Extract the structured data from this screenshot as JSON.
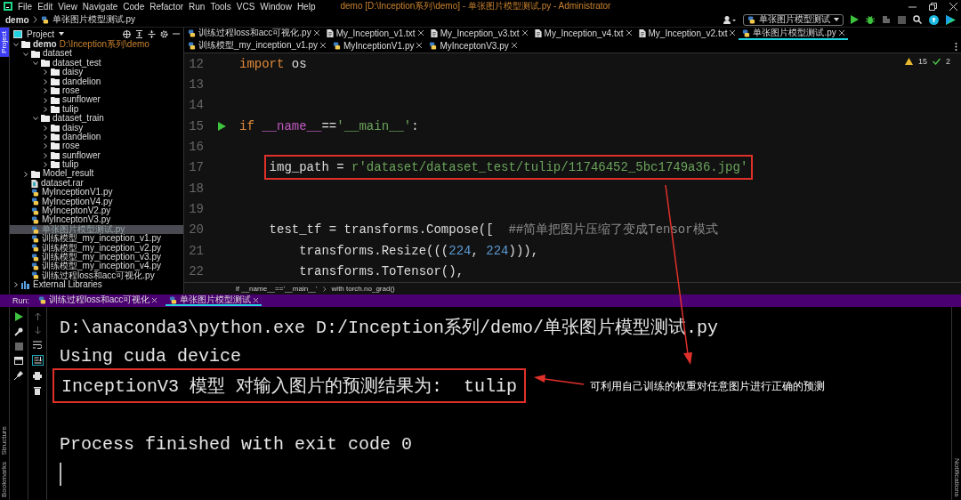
{
  "menu_bar": {
    "items": [
      "File",
      "Edit",
      "View",
      "Navigate",
      "Code",
      "Refactor",
      "Run",
      "Tools",
      "VCS",
      "Window",
      "Help"
    ],
    "title": "demo [D:\\Inception系列\\demo] - 单张图片模型测试.py - Administrator"
  },
  "navigation_bar": {
    "breadcrumbs": [
      "demo",
      "单张图片模型测试.py"
    ],
    "run_configuration": "单张图片模型测试"
  },
  "stripes": {
    "left_top": [
      {
        "label": "Project",
        "selected": true
      }
    ],
    "left_bottom": [
      {
        "label": "Structure",
        "selected": false
      },
      {
        "label": "Bookmarks",
        "selected": false
      }
    ],
    "right_bottom": [
      {
        "label": "Notifications",
        "selected": false
      }
    ]
  },
  "project_panel": {
    "title": "Project",
    "tree": [
      {
        "label": "demo",
        "path": "D:\\Inception系列\\demo",
        "kind": "folder",
        "expanded": true,
        "selected": false,
        "children": [
          {
            "label": "dataset",
            "kind": "folder",
            "expanded": true,
            "selected": false,
            "children": [
              {
                "label": "dataset_test",
                "kind": "folder",
                "expanded": true,
                "selected": false,
                "children": [
                  {
                    "label": "daisy",
                    "kind": "folder",
                    "expanded": false,
                    "selected": false
                  },
                  {
                    "label": "dandelion",
                    "kind": "folder",
                    "expanded": false,
                    "selected": false
                  },
                  {
                    "label": "rose",
                    "kind": "folder",
                    "expanded": false,
                    "selected": false
                  },
                  {
                    "label": "sunflower",
                    "kind": "folder",
                    "expanded": false,
                    "selected": false
                  },
                  {
                    "label": "tulip",
                    "kind": "folder",
                    "expanded": false,
                    "selected": false
                  }
                ]
              },
              {
                "label": "dataset_train",
                "kind": "folder",
                "expanded": true,
                "selected": false,
                "children": [
                  {
                    "label": "daisy",
                    "kind": "folder",
                    "expanded": false,
                    "selected": false
                  },
                  {
                    "label": "dandelion",
                    "kind": "folder",
                    "expanded": false,
                    "selected": false
                  },
                  {
                    "label": "rose",
                    "kind": "folder",
                    "expanded": false,
                    "selected": false
                  },
                  {
                    "label": "sunflower",
                    "kind": "folder",
                    "expanded": false,
                    "selected": false
                  },
                  {
                    "label": "tulip",
                    "kind": "folder",
                    "expanded": false,
                    "selected": false
                  }
                ]
              }
            ]
          },
          {
            "label": "Model_result",
            "kind": "folder",
            "expanded": false,
            "selected": false
          },
          {
            "label": "dataset.rar",
            "kind": "archive",
            "selected": false
          },
          {
            "label": "MyInceptionV1.py",
            "kind": "python",
            "selected": false
          },
          {
            "label": "MyInceptionV4.py",
            "kind": "python",
            "selected": false
          },
          {
            "label": "MyInceptonV2.py",
            "kind": "python",
            "selected": false
          },
          {
            "label": "MyInceptonV3.py",
            "kind": "python",
            "selected": false
          },
          {
            "label": "单张图片模型测试.py",
            "kind": "python",
            "selected": true
          },
          {
            "label": "训练模型_my_inception_v1.py",
            "kind": "python",
            "selected": false
          },
          {
            "label": "训练模型_my_inception_v2.py",
            "kind": "python",
            "selected": false
          },
          {
            "label": "训练模型_my_inception_v3.py",
            "kind": "python",
            "selected": false
          },
          {
            "label": "训练模型_my_inception_v4.py",
            "kind": "python",
            "selected": false
          },
          {
            "label": "训练过程loss和acc可视化.py",
            "kind": "python",
            "selected": false
          }
        ]
      },
      {
        "label": "External Libraries",
        "kind": "library",
        "expanded": false,
        "selected": false
      }
    ]
  },
  "editor": {
    "tabs": [
      {
        "label": "训练过程loss和acc可视化.py",
        "kind": "python",
        "selected": false
      },
      {
        "label": "My_Inception_v1.txt",
        "kind": "text",
        "selected": false
      },
      {
        "label": "My_Inception_v3.txt",
        "kind": "text",
        "selected": false
      },
      {
        "label": "My_Inception_v4.txt",
        "kind": "text",
        "selected": false
      },
      {
        "label": "My_Inception_v2.txt",
        "kind": "text",
        "selected": false
      },
      {
        "label": "单张图片模型测试.py",
        "kind": "python",
        "selected": true
      },
      {
        "label": "训练模型_my_inception_v1.py",
        "kind": "python",
        "selected": false
      },
      {
        "label": "MyInceptionV1.py",
        "kind": "python",
        "selected": false
      },
      {
        "label": "MyInceptonV3.py",
        "kind": "python",
        "selected": false
      }
    ],
    "inspections": {
      "warnings": "15",
      "checks": "2"
    },
    "lines": [
      {
        "number": "12",
        "tokens": [
          {
            "kind": "keyword",
            "text": "import"
          },
          {
            "kind": "plain",
            "text": " os"
          }
        ]
      },
      {
        "number": "13"
      },
      {
        "number": "14"
      },
      {
        "number": "15",
        "run_marker": true,
        "tokens": [
          {
            "kind": "keyword",
            "text": "if"
          },
          {
            "kind": "dunder",
            "text": " __name__"
          },
          {
            "kind": "plain",
            "text": "=="
          },
          {
            "kind": "string",
            "text": "'__main__'"
          },
          {
            "kind": "plain",
            "text": ":"
          }
        ]
      },
      {
        "number": "16"
      },
      {
        "number": "17",
        "boxed": true,
        "tokens": [
          {
            "kind": "plain",
            "text": "    img_path = "
          },
          {
            "kind": "string",
            "text": "r'dataset/dataset_test/tulip/11746452_5bc1749a36.jpg'"
          }
        ]
      },
      {
        "number": "18"
      },
      {
        "number": "19"
      },
      {
        "number": "20",
        "tokens": [
          {
            "kind": "plain",
            "text": "    test_tf = transforms.Compose([  "
          },
          {
            "kind": "comment",
            "text": "##简单把图片压缩了变成Tensor模式"
          }
        ]
      },
      {
        "number": "21",
        "tokens": [
          {
            "kind": "plain",
            "text": "        transforms.Resize((("
          },
          {
            "kind": "number",
            "text": "224"
          },
          {
            "kind": "plain",
            "text": ", "
          },
          {
            "kind": "number",
            "text": "224"
          },
          {
            "kind": "plain",
            "text": "))),"
          }
        ]
      },
      {
        "number": "22",
        "tokens": [
          {
            "kind": "plain",
            "text": "        transforms.ToTensor(),"
          }
        ]
      }
    ],
    "breadcrumbs": [
      "if __name__=='__main__'",
      "with torch.no_grad()"
    ]
  },
  "run_panel": {
    "label": "Run:",
    "tabs": [
      {
        "label": "训练过程loss和acc可视化",
        "selected": false
      },
      {
        "label": "单张图片模型测试",
        "selected": true
      }
    ],
    "output_blocks": [
      [
        {
          "text": "D:\\anaconda3\\python.exe D:/Inception系列/demo/单张图片模型测试.py",
          "boxed": false
        },
        {
          "text": "Using cuda device",
          "boxed": false
        },
        {
          "text": "InceptionV3 模型 对输入图片的预测结果为:  tulip",
          "boxed": true
        }
      ],
      [
        {
          "text": "Process finished with exit code 0",
          "boxed": false
        }
      ]
    ]
  },
  "annotation": {
    "text": "可利用自己训练的权重对任意图片进行正确的预测"
  }
}
